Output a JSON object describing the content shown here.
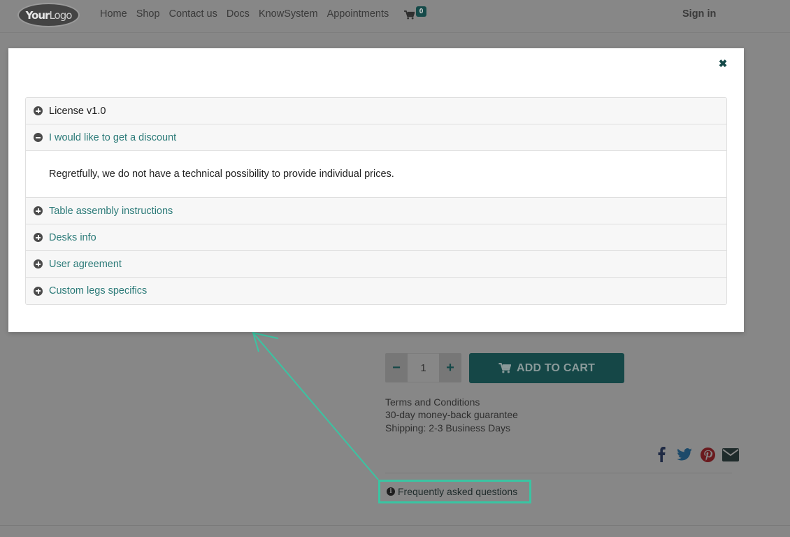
{
  "navbar": {
    "logo_text_bold": "Your",
    "logo_text": "Logo",
    "links": [
      "Home",
      "Shop",
      "Contact us",
      "Docs",
      "KnowSystem",
      "Appointments"
    ],
    "cart_icon": "shopping-cart-icon",
    "cart_count": "0",
    "sign_in": "Sign in"
  },
  "product": {
    "quantity": "1",
    "decrease_icon": "minus-icon",
    "increase_icon": "plus-icon",
    "add_to_cart": "ADD TO CART",
    "terms": [
      "Terms and Conditions",
      "30-day money-back guarantee",
      "Shipping: 2-3 Business Days"
    ],
    "share_icons": [
      "facebook-icon",
      "twitter-icon",
      "pinterest-icon",
      "email-icon"
    ],
    "faq_link": "Frequently asked questions"
  },
  "modal": {
    "close_icon": "close-icon",
    "items": [
      {
        "title": "License v1.0",
        "expanded": false
      },
      {
        "title": "I would like to get a discount",
        "expanded": true,
        "body": "Regretfully, we do not have a technical possibility to provide individual prices."
      },
      {
        "title": "Table assembly instructions",
        "expanded": false
      },
      {
        "title": "Desks info",
        "expanded": false
      },
      {
        "title": "User agreement",
        "expanded": false
      },
      {
        "title": "Custom legs specifics",
        "expanded": false
      }
    ]
  },
  "colors": {
    "overlay_bg": "#878787",
    "accent": "#2b7a78",
    "highlight": "#3ac4a2"
  }
}
